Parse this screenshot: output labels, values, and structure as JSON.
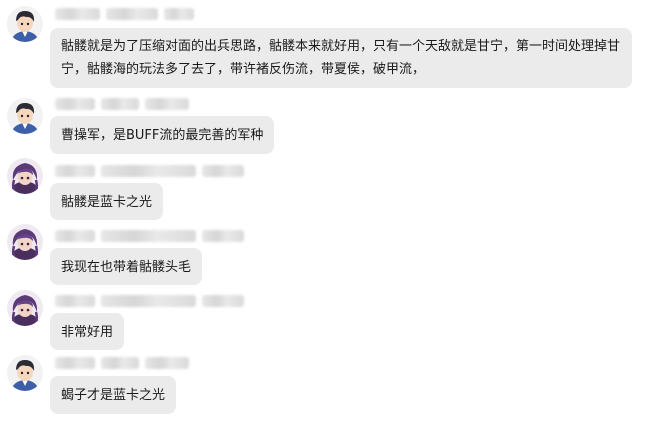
{
  "messages": [
    {
      "sender_type": "male",
      "text": "骷髅就是为了压缩对面的出兵思路，骷髅本来就好用，只有一个天敌就是甘宁，第一时间处理掉甘宁，骷髅海的玩法多了去了，带许褚反伤流，带夏侯，破甲流，"
    },
    {
      "sender_type": "male",
      "text": "曹操军，是BUFF流的最完善的军种"
    },
    {
      "sender_type": "female",
      "text": "骷髅是蓝卡之光"
    },
    {
      "sender_type": "female",
      "text": "我现在也带着骷髅头毛"
    },
    {
      "sender_type": "female",
      "text": "非常好用"
    },
    {
      "sender_type": "male",
      "text": "蝎子才是蓝卡之光"
    }
  ],
  "colors": {
    "bubble_bg": "#ebebeb",
    "page_bg": "#ffffff"
  },
  "icons": {
    "male_avatar": "anime-boy-avatar-icon",
    "female_avatar": "anime-girl-avatar-icon"
  }
}
